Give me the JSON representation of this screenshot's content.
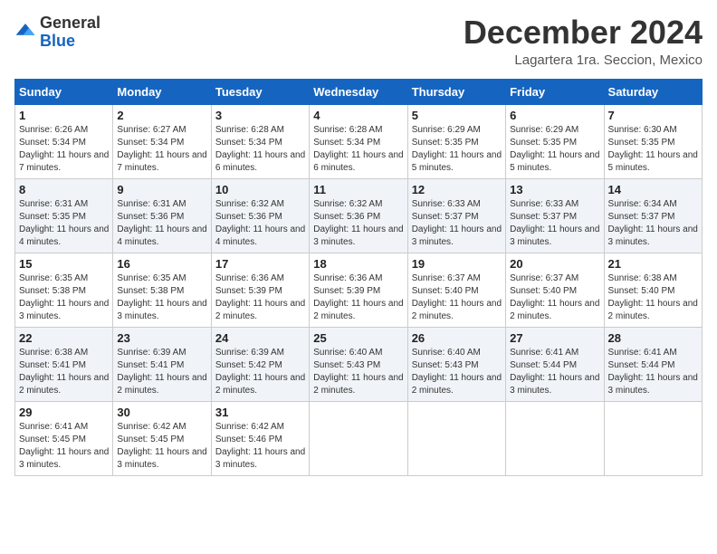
{
  "logo": {
    "general": "General",
    "blue": "Blue"
  },
  "header": {
    "month_title": "December 2024",
    "location": "Lagartera 1ra. Seccion, Mexico"
  },
  "days_of_week": [
    "Sunday",
    "Monday",
    "Tuesday",
    "Wednesday",
    "Thursday",
    "Friday",
    "Saturday"
  ],
  "weeks": [
    [
      {
        "day": "1",
        "sunrise": "6:26 AM",
        "sunset": "5:34 PM",
        "daylight": "11 hours and 7 minutes."
      },
      {
        "day": "2",
        "sunrise": "6:27 AM",
        "sunset": "5:34 PM",
        "daylight": "11 hours and 7 minutes."
      },
      {
        "day": "3",
        "sunrise": "6:28 AM",
        "sunset": "5:34 PM",
        "daylight": "11 hours and 6 minutes."
      },
      {
        "day": "4",
        "sunrise": "6:28 AM",
        "sunset": "5:34 PM",
        "daylight": "11 hours and 6 minutes."
      },
      {
        "day": "5",
        "sunrise": "6:29 AM",
        "sunset": "5:35 PM",
        "daylight": "11 hours and 5 minutes."
      },
      {
        "day": "6",
        "sunrise": "6:29 AM",
        "sunset": "5:35 PM",
        "daylight": "11 hours and 5 minutes."
      },
      {
        "day": "7",
        "sunrise": "6:30 AM",
        "sunset": "5:35 PM",
        "daylight": "11 hours and 5 minutes."
      }
    ],
    [
      {
        "day": "8",
        "sunrise": "6:31 AM",
        "sunset": "5:35 PM",
        "daylight": "11 hours and 4 minutes."
      },
      {
        "day": "9",
        "sunrise": "6:31 AM",
        "sunset": "5:36 PM",
        "daylight": "11 hours and 4 minutes."
      },
      {
        "day": "10",
        "sunrise": "6:32 AM",
        "sunset": "5:36 PM",
        "daylight": "11 hours and 4 minutes."
      },
      {
        "day": "11",
        "sunrise": "6:32 AM",
        "sunset": "5:36 PM",
        "daylight": "11 hours and 3 minutes."
      },
      {
        "day": "12",
        "sunrise": "6:33 AM",
        "sunset": "5:37 PM",
        "daylight": "11 hours and 3 minutes."
      },
      {
        "day": "13",
        "sunrise": "6:33 AM",
        "sunset": "5:37 PM",
        "daylight": "11 hours and 3 minutes."
      },
      {
        "day": "14",
        "sunrise": "6:34 AM",
        "sunset": "5:37 PM",
        "daylight": "11 hours and 3 minutes."
      }
    ],
    [
      {
        "day": "15",
        "sunrise": "6:35 AM",
        "sunset": "5:38 PM",
        "daylight": "11 hours and 3 minutes."
      },
      {
        "day": "16",
        "sunrise": "6:35 AM",
        "sunset": "5:38 PM",
        "daylight": "11 hours and 3 minutes."
      },
      {
        "day": "17",
        "sunrise": "6:36 AM",
        "sunset": "5:39 PM",
        "daylight": "11 hours and 2 minutes."
      },
      {
        "day": "18",
        "sunrise": "6:36 AM",
        "sunset": "5:39 PM",
        "daylight": "11 hours and 2 minutes."
      },
      {
        "day": "19",
        "sunrise": "6:37 AM",
        "sunset": "5:40 PM",
        "daylight": "11 hours and 2 minutes."
      },
      {
        "day": "20",
        "sunrise": "6:37 AM",
        "sunset": "5:40 PM",
        "daylight": "11 hours and 2 minutes."
      },
      {
        "day": "21",
        "sunrise": "6:38 AM",
        "sunset": "5:40 PM",
        "daylight": "11 hours and 2 minutes."
      }
    ],
    [
      {
        "day": "22",
        "sunrise": "6:38 AM",
        "sunset": "5:41 PM",
        "daylight": "11 hours and 2 minutes."
      },
      {
        "day": "23",
        "sunrise": "6:39 AM",
        "sunset": "5:41 PM",
        "daylight": "11 hours and 2 minutes."
      },
      {
        "day": "24",
        "sunrise": "6:39 AM",
        "sunset": "5:42 PM",
        "daylight": "11 hours and 2 minutes."
      },
      {
        "day": "25",
        "sunrise": "6:40 AM",
        "sunset": "5:43 PM",
        "daylight": "11 hours and 2 minutes."
      },
      {
        "day": "26",
        "sunrise": "6:40 AM",
        "sunset": "5:43 PM",
        "daylight": "11 hours and 2 minutes."
      },
      {
        "day": "27",
        "sunrise": "6:41 AM",
        "sunset": "5:44 PM",
        "daylight": "11 hours and 3 minutes."
      },
      {
        "day": "28",
        "sunrise": "6:41 AM",
        "sunset": "5:44 PM",
        "daylight": "11 hours and 3 minutes."
      }
    ],
    [
      {
        "day": "29",
        "sunrise": "6:41 AM",
        "sunset": "5:45 PM",
        "daylight": "11 hours and 3 minutes."
      },
      {
        "day": "30",
        "sunrise": "6:42 AM",
        "sunset": "5:45 PM",
        "daylight": "11 hours and 3 minutes."
      },
      {
        "day": "31",
        "sunrise": "6:42 AM",
        "sunset": "5:46 PM",
        "daylight": "11 hours and 3 minutes."
      },
      null,
      null,
      null,
      null
    ]
  ],
  "labels": {
    "sunrise": "Sunrise:",
    "sunset": "Sunset:",
    "daylight": "Daylight:"
  }
}
